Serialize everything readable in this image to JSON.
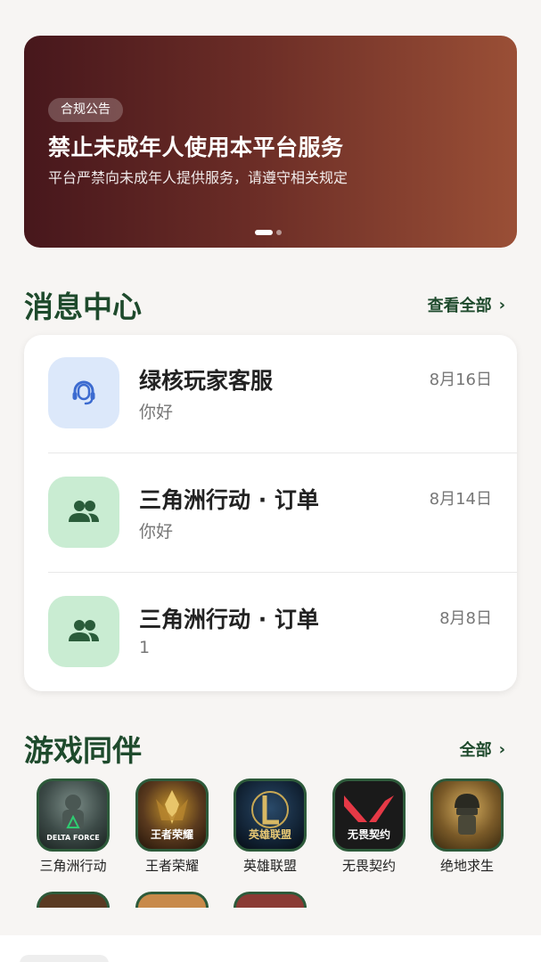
{
  "banner": {
    "badge": "合规公告",
    "title": "禁止未成年人使用本平台服务",
    "subtitle": "平台严禁向未成年人提供服务，请遵守相关规定"
  },
  "messages": {
    "title": "消息中心",
    "view_all": "查看全部",
    "items": [
      {
        "name": "绿核玩家客服",
        "preview": "你好",
        "date": "8月16日",
        "icon": "headset-icon",
        "icon_bg": "#dce8fa",
        "icon_color": "#3c6bd0"
      },
      {
        "name": "三角洲行动 · 订单",
        "preview": "你好",
        "date": "8月14日",
        "icon": "group-icon",
        "icon_bg": "#c9ecd2",
        "icon_color": "#2a5c3a"
      },
      {
        "name": "三角洲行动 · 订单",
        "preview": "1",
        "date": "8月8日",
        "icon": "group-icon",
        "icon_bg": "#c9ecd2",
        "icon_color": "#2a5c3a"
      }
    ]
  },
  "games": {
    "title": "游戏同伴",
    "all": "全部",
    "items": [
      {
        "label": "三角洲行动",
        "icon_text": "DELTA FORCE"
      },
      {
        "label": "王者荣耀",
        "icon_text": "王者荣耀"
      },
      {
        "label": "英雄联盟",
        "icon_text": "英雄联盟"
      },
      {
        "label": "无畏契约",
        "icon_text": "无畏契约"
      },
      {
        "label": "绝地求生",
        "icon_text": ""
      }
    ]
  },
  "colors": {
    "accent": "#1e4a2c",
    "banner_start": "#47171c",
    "banner_end": "#9a4f36"
  }
}
